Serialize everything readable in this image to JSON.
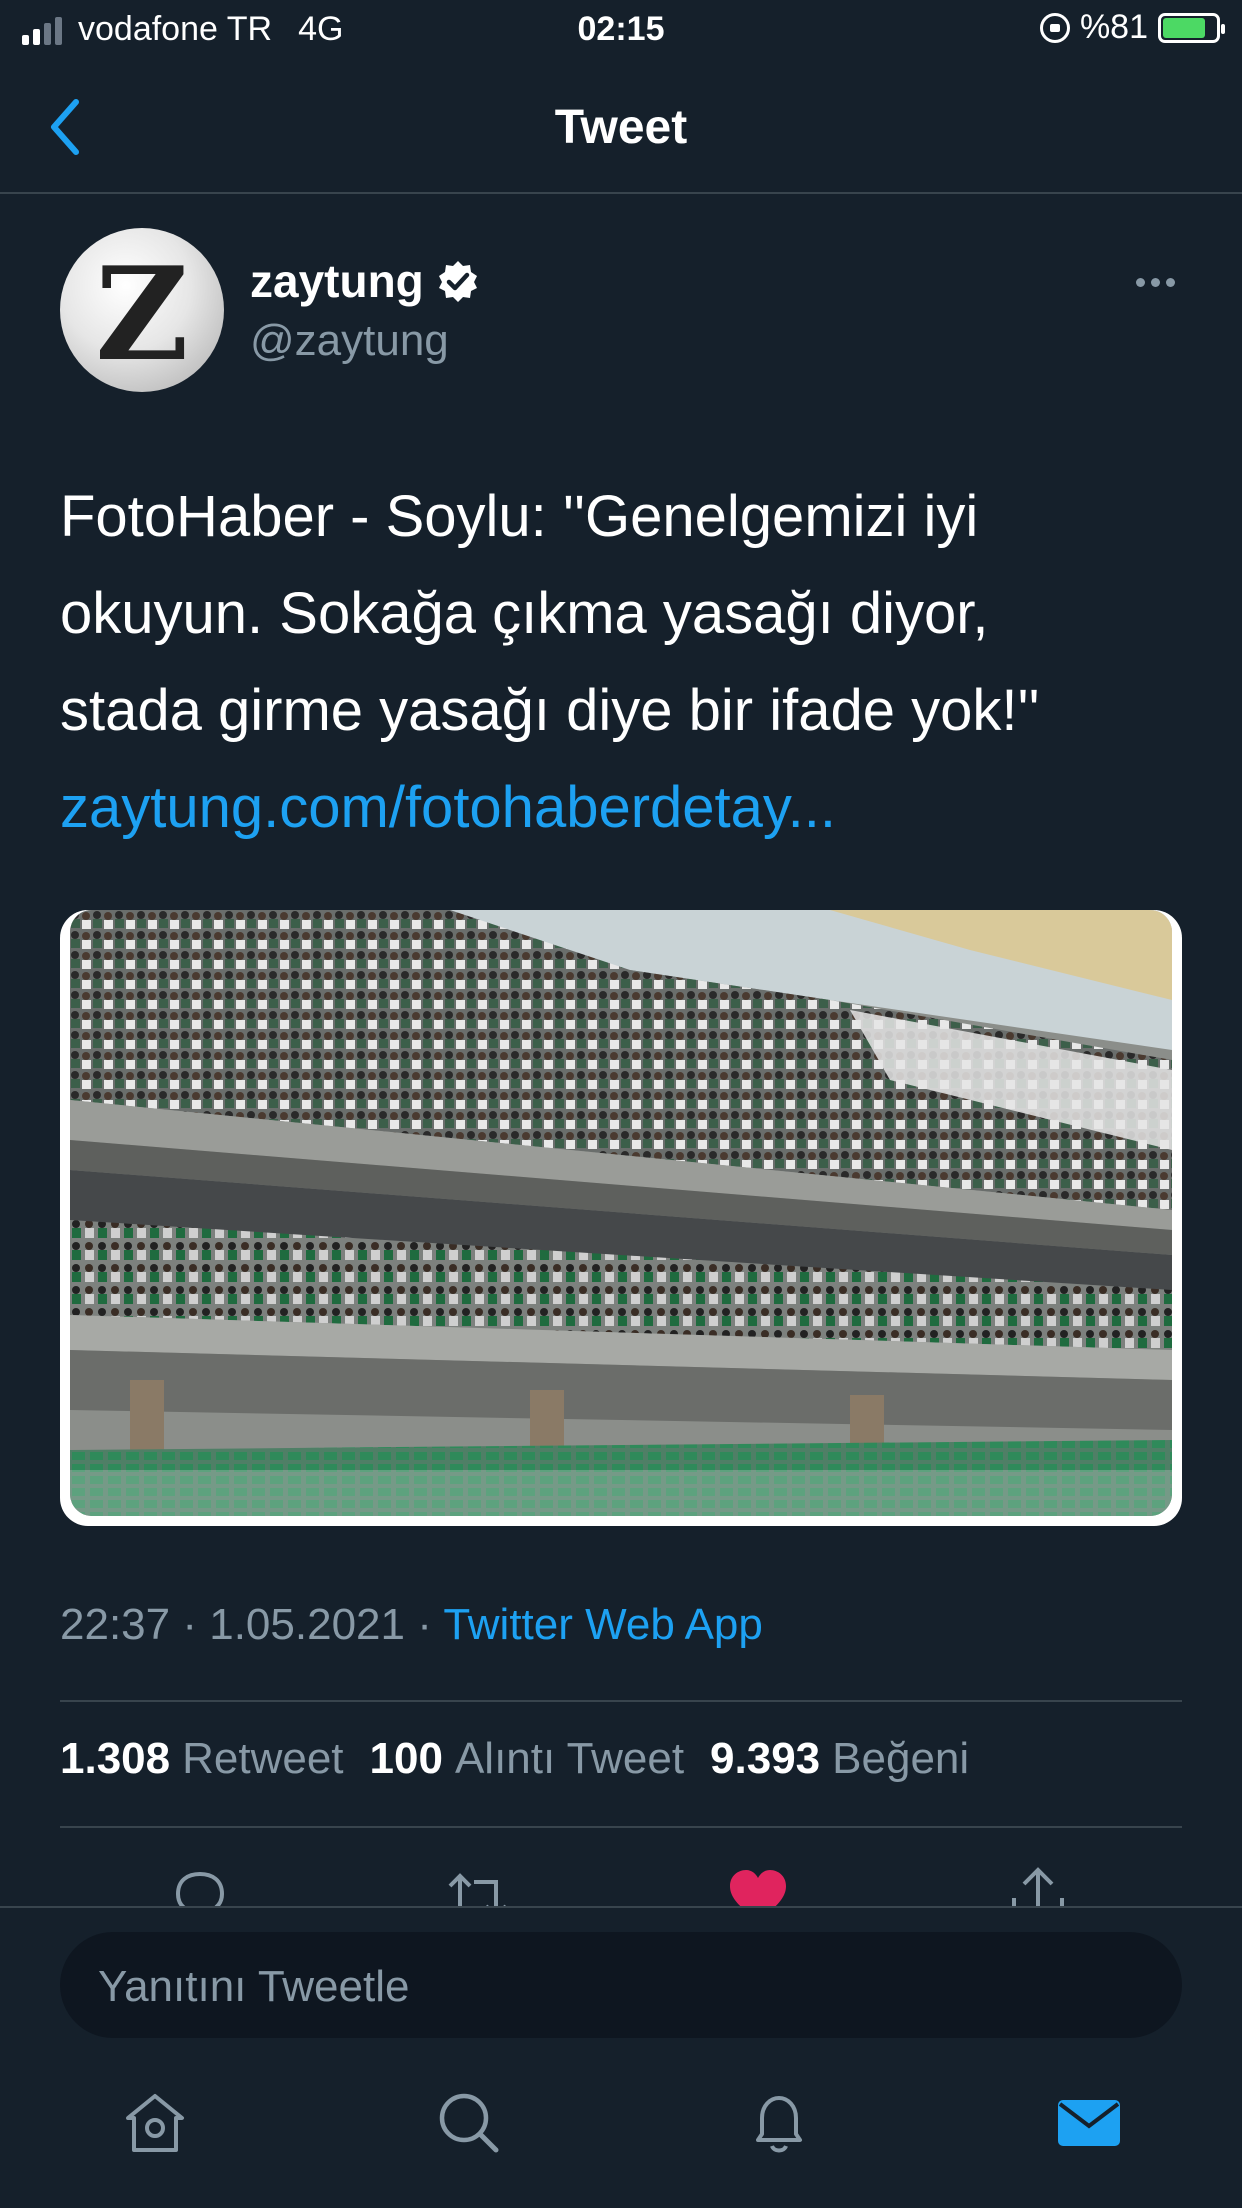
{
  "status_bar": {
    "carrier": "vodafone TR",
    "network": "4G",
    "time": "02:15",
    "battery": "%81",
    "battery_level": 0.81,
    "signal_bars": 2
  },
  "header": {
    "title": "Tweet"
  },
  "tweet": {
    "author_name": "zaytung",
    "author_handle": "@zaytung",
    "avatar_letter": "Z",
    "verified": true,
    "text_lines": [
      "FotoHaber - Soylu: ''Genelgemizi iyi",
      "okuyun. Sokağa çıkma yasağı diyor,",
      "stada girme yasağı diye bir ifade yok!''"
    ],
    "link": "zaytung.com/fotohaberdetay...",
    "time": "22:37",
    "date": "1.05.2021",
    "separator": "·",
    "source_app": "Twitter Web App"
  },
  "stats": {
    "retweets_count": "1.308",
    "retweets_label": "Retweet",
    "quotes_count": "100",
    "quotes_label": "Alıntı Tweet",
    "likes_count": "9.393",
    "likes_label": "Beğeni"
  },
  "reply": {
    "placeholder": "Yanıtını Tweetle"
  },
  "colors": {
    "background": "#15202b",
    "accent": "#1da1f2",
    "secondary_text": "#8899a6",
    "like": "#e0245e",
    "divider": "#38444d"
  },
  "icons": [
    "chevron-left-icon",
    "verified-badge-icon",
    "more-icon",
    "reply-icon",
    "retweet-icon",
    "like-icon",
    "share-icon",
    "home-icon",
    "search-icon",
    "notifications-icon",
    "messages-icon"
  ]
}
